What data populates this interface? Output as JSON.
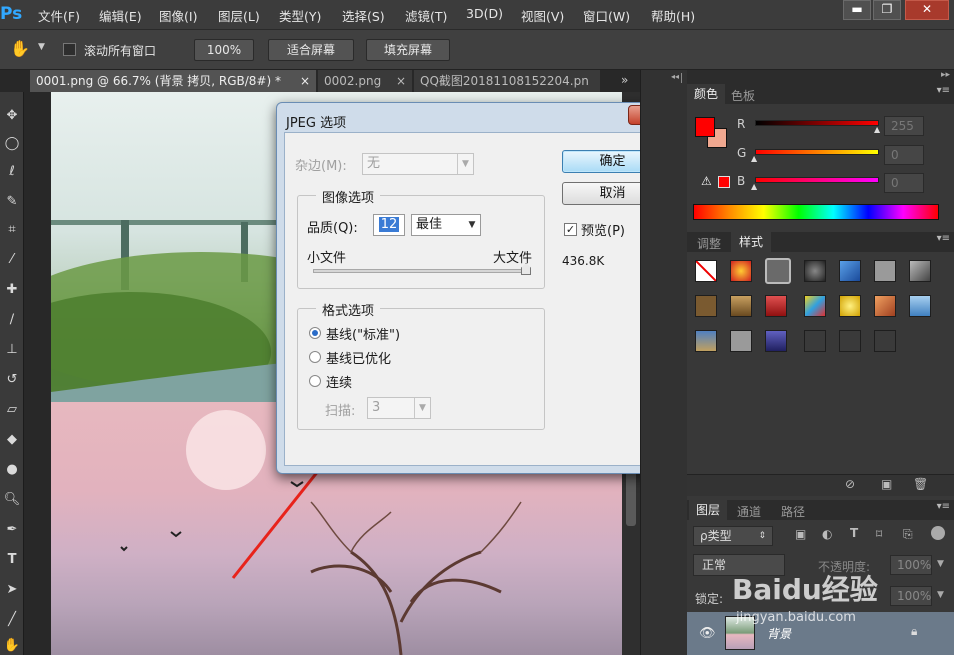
{
  "app": {
    "logo": "Ps"
  },
  "menu": [
    "文件(F)",
    "编辑(E)",
    "图像(I)",
    "图层(L)",
    "类型(Y)",
    "选择(S)",
    "滤镜(T)",
    "3D(D)",
    "视图(V)",
    "窗口(W)",
    "帮助(H)"
  ],
  "window_controls": {
    "minimize": "▬",
    "restore": "❐",
    "close": "✕"
  },
  "options_bar": {
    "tool_icon": "hand-icon",
    "scroll_all_windows": "滚动所有窗口",
    "zoom_100": "100%",
    "fit_screen": "适合屏幕",
    "fill_screen": "填充屏幕"
  },
  "tabs": [
    {
      "label": "0001.png @ 66.7% (背景 拷贝, RGB/8#) *",
      "close": "×",
      "active": true
    },
    {
      "label": "0002.png",
      "close": "×",
      "active": false
    },
    {
      "label": "QQ截图20181108152204.pn",
      "close": "",
      "active": false
    }
  ],
  "tabs_overflow": "»",
  "dialog": {
    "title": "JPEG 选项",
    "close": "✕",
    "matte_label": "杂边(M):",
    "matte_value": "无",
    "image_options_legend": "图像选项",
    "quality_label": "品质(Q):",
    "quality_value": "12",
    "quality_preset": "最佳",
    "small_file": "小文件",
    "large_file": "大文件",
    "format_options_legend": "格式选项",
    "formats": [
      {
        "label": "基线(\"标准\")",
        "checked": true
      },
      {
        "label": "基线已优化",
        "checked": false
      },
      {
        "label": "连续",
        "checked": false
      }
    ],
    "scans_label": "扫描:",
    "scans_value": "3",
    "ok": "确定",
    "cancel": "取消",
    "preview_label": "预览(P)",
    "preview_checked": true,
    "file_size": "436.8K"
  },
  "color_panel": {
    "tabs": [
      "颜色",
      "色板"
    ],
    "r_label": "R",
    "r_value": "255",
    "g_label": "G",
    "g_value": "0",
    "b_label": "B",
    "b_value": "0",
    "foreground": "#ff0000",
    "background": "#f0a890"
  },
  "styles_panel": {
    "tabs": [
      "调整",
      "样式"
    ]
  },
  "layers_panel": {
    "tabs": [
      "图层",
      "通道",
      "路径"
    ],
    "filter_type": "ρ类型",
    "blend_mode": "正常",
    "opacity_label": "不透明度:",
    "opacity_value": "100%",
    "lock_label": "锁定:",
    "fill_value": "100%",
    "layer_name": "背景"
  },
  "watermark": {
    "brand": "Baidu经验",
    "url": "jingyan.baidu.com"
  }
}
